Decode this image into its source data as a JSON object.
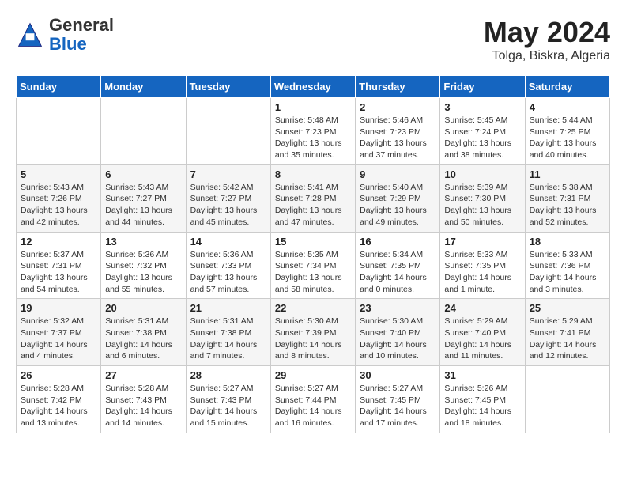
{
  "header": {
    "logo_general": "General",
    "logo_blue": "Blue",
    "month_year": "May 2024",
    "location": "Tolga, Biskra, Algeria"
  },
  "days_of_week": [
    "Sunday",
    "Monday",
    "Tuesday",
    "Wednesday",
    "Thursday",
    "Friday",
    "Saturday"
  ],
  "weeks": [
    [
      {
        "day": "",
        "content": ""
      },
      {
        "day": "",
        "content": ""
      },
      {
        "day": "",
        "content": ""
      },
      {
        "day": "1",
        "content": "Sunrise: 5:48 AM\nSunset: 7:23 PM\nDaylight: 13 hours\nand 35 minutes."
      },
      {
        "day": "2",
        "content": "Sunrise: 5:46 AM\nSunset: 7:23 PM\nDaylight: 13 hours\nand 37 minutes."
      },
      {
        "day": "3",
        "content": "Sunrise: 5:45 AM\nSunset: 7:24 PM\nDaylight: 13 hours\nand 38 minutes."
      },
      {
        "day": "4",
        "content": "Sunrise: 5:44 AM\nSunset: 7:25 PM\nDaylight: 13 hours\nand 40 minutes."
      }
    ],
    [
      {
        "day": "5",
        "content": "Sunrise: 5:43 AM\nSunset: 7:26 PM\nDaylight: 13 hours\nand 42 minutes."
      },
      {
        "day": "6",
        "content": "Sunrise: 5:43 AM\nSunset: 7:27 PM\nDaylight: 13 hours\nand 44 minutes."
      },
      {
        "day": "7",
        "content": "Sunrise: 5:42 AM\nSunset: 7:27 PM\nDaylight: 13 hours\nand 45 minutes."
      },
      {
        "day": "8",
        "content": "Sunrise: 5:41 AM\nSunset: 7:28 PM\nDaylight: 13 hours\nand 47 minutes."
      },
      {
        "day": "9",
        "content": "Sunrise: 5:40 AM\nSunset: 7:29 PM\nDaylight: 13 hours\nand 49 minutes."
      },
      {
        "day": "10",
        "content": "Sunrise: 5:39 AM\nSunset: 7:30 PM\nDaylight: 13 hours\nand 50 minutes."
      },
      {
        "day": "11",
        "content": "Sunrise: 5:38 AM\nSunset: 7:31 PM\nDaylight: 13 hours\nand 52 minutes."
      }
    ],
    [
      {
        "day": "12",
        "content": "Sunrise: 5:37 AM\nSunset: 7:31 PM\nDaylight: 13 hours\nand 54 minutes."
      },
      {
        "day": "13",
        "content": "Sunrise: 5:36 AM\nSunset: 7:32 PM\nDaylight: 13 hours\nand 55 minutes."
      },
      {
        "day": "14",
        "content": "Sunrise: 5:36 AM\nSunset: 7:33 PM\nDaylight: 13 hours\nand 57 minutes."
      },
      {
        "day": "15",
        "content": "Sunrise: 5:35 AM\nSunset: 7:34 PM\nDaylight: 13 hours\nand 58 minutes."
      },
      {
        "day": "16",
        "content": "Sunrise: 5:34 AM\nSunset: 7:35 PM\nDaylight: 14 hours\nand 0 minutes."
      },
      {
        "day": "17",
        "content": "Sunrise: 5:33 AM\nSunset: 7:35 PM\nDaylight: 14 hours\nand 1 minute."
      },
      {
        "day": "18",
        "content": "Sunrise: 5:33 AM\nSunset: 7:36 PM\nDaylight: 14 hours\nand 3 minutes."
      }
    ],
    [
      {
        "day": "19",
        "content": "Sunrise: 5:32 AM\nSunset: 7:37 PM\nDaylight: 14 hours\nand 4 minutes."
      },
      {
        "day": "20",
        "content": "Sunrise: 5:31 AM\nSunset: 7:38 PM\nDaylight: 14 hours\nand 6 minutes."
      },
      {
        "day": "21",
        "content": "Sunrise: 5:31 AM\nSunset: 7:38 PM\nDaylight: 14 hours\nand 7 minutes."
      },
      {
        "day": "22",
        "content": "Sunrise: 5:30 AM\nSunset: 7:39 PM\nDaylight: 14 hours\nand 8 minutes."
      },
      {
        "day": "23",
        "content": "Sunrise: 5:30 AM\nSunset: 7:40 PM\nDaylight: 14 hours\nand 10 minutes."
      },
      {
        "day": "24",
        "content": "Sunrise: 5:29 AM\nSunset: 7:40 PM\nDaylight: 14 hours\nand 11 minutes."
      },
      {
        "day": "25",
        "content": "Sunrise: 5:29 AM\nSunset: 7:41 PM\nDaylight: 14 hours\nand 12 minutes."
      }
    ],
    [
      {
        "day": "26",
        "content": "Sunrise: 5:28 AM\nSunset: 7:42 PM\nDaylight: 14 hours\nand 13 minutes."
      },
      {
        "day": "27",
        "content": "Sunrise: 5:28 AM\nSunset: 7:43 PM\nDaylight: 14 hours\nand 14 minutes."
      },
      {
        "day": "28",
        "content": "Sunrise: 5:27 AM\nSunset: 7:43 PM\nDaylight: 14 hours\nand 15 minutes."
      },
      {
        "day": "29",
        "content": "Sunrise: 5:27 AM\nSunset: 7:44 PM\nDaylight: 14 hours\nand 16 minutes."
      },
      {
        "day": "30",
        "content": "Sunrise: 5:27 AM\nSunset: 7:45 PM\nDaylight: 14 hours\nand 17 minutes."
      },
      {
        "day": "31",
        "content": "Sunrise: 5:26 AM\nSunset: 7:45 PM\nDaylight: 14 hours\nand 18 minutes."
      },
      {
        "day": "",
        "content": ""
      }
    ]
  ]
}
